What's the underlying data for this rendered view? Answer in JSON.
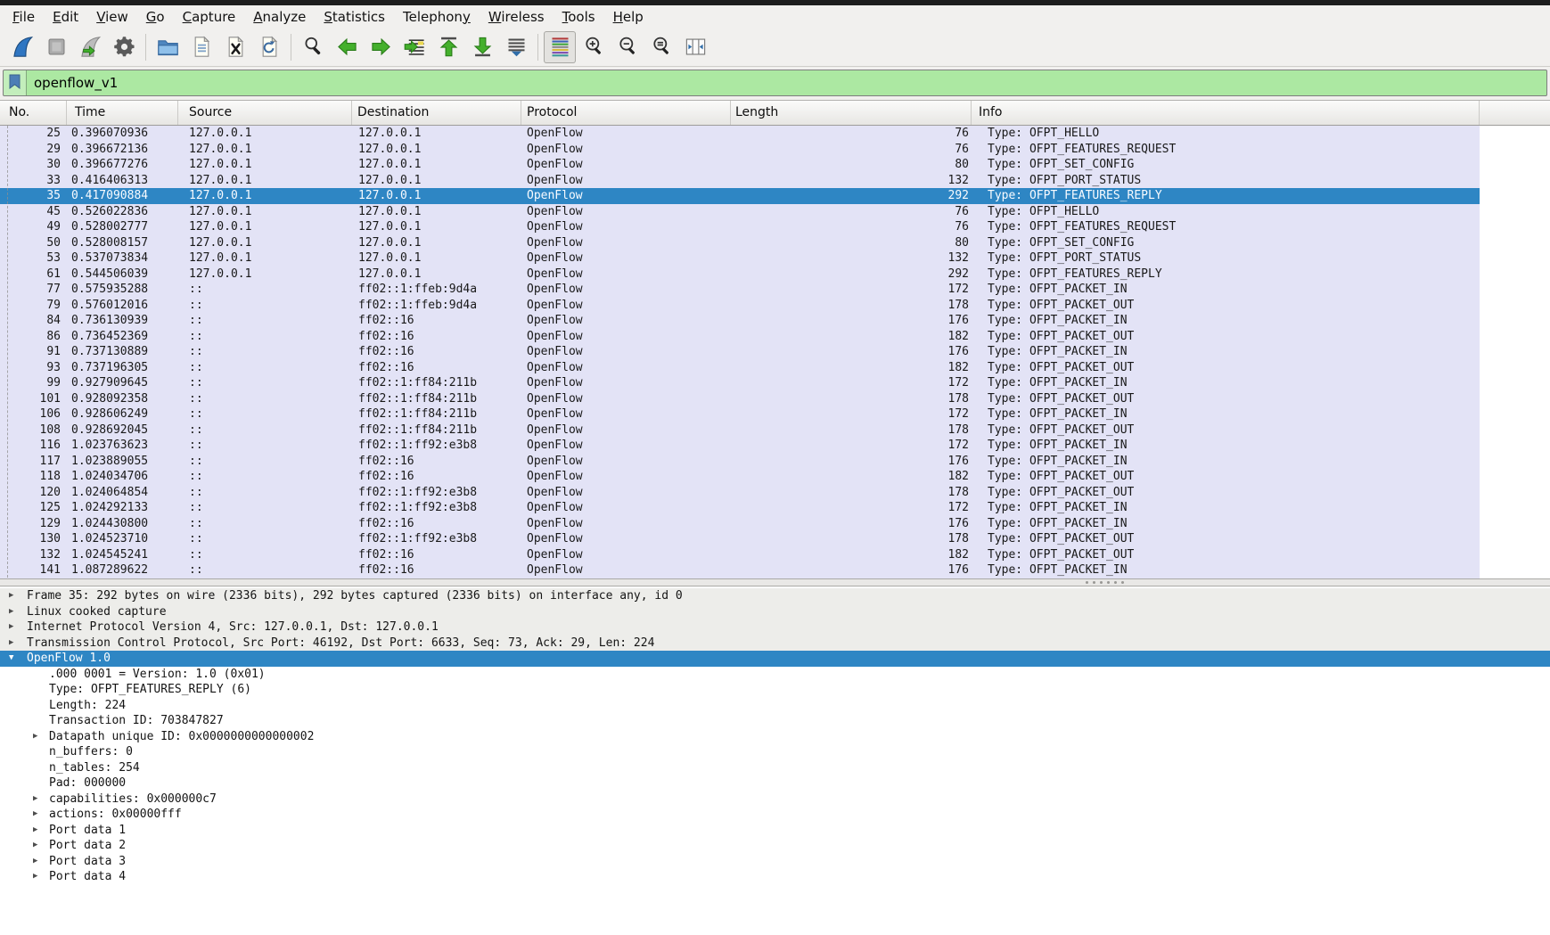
{
  "colors": {
    "selection_blue": "#2e86c4",
    "packet_row_lavender": "#e3e3f6",
    "filter_valid_green": "#ace8a2",
    "toolbar_gray": "#f1f0ee",
    "detail_shaded_gray": "#ededea"
  },
  "menu": {
    "items": [
      {
        "name": "file",
        "pre": "",
        "mn": "F",
        "post": "ile"
      },
      {
        "name": "edit",
        "pre": "",
        "mn": "E",
        "post": "dit"
      },
      {
        "name": "view",
        "pre": "",
        "mn": "V",
        "post": "iew"
      },
      {
        "name": "go",
        "pre": "",
        "mn": "G",
        "post": "o"
      },
      {
        "name": "capture",
        "pre": "",
        "mn": "C",
        "post": "apture"
      },
      {
        "name": "analyze",
        "pre": "",
        "mn": "A",
        "post": "nalyze"
      },
      {
        "name": "statistics",
        "pre": "",
        "mn": "S",
        "post": "tatistics"
      },
      {
        "name": "telephony",
        "pre": "Telephon",
        "mn": "y",
        "post": ""
      },
      {
        "name": "wireless",
        "pre": "",
        "mn": "W",
        "post": "ireless"
      },
      {
        "name": "tools",
        "pre": "",
        "mn": "T",
        "post": "ools"
      },
      {
        "name": "help",
        "pre": "",
        "mn": "H",
        "post": "elp"
      }
    ]
  },
  "toolbar": {
    "buttons": [
      {
        "name": "start-capture",
        "icon": "wireshark-fin-start-icon"
      },
      {
        "name": "stop-capture",
        "icon": "stop-icon"
      },
      {
        "name": "restart-capture",
        "icon": "restart-capture-icon"
      },
      {
        "name": "capture-options",
        "icon": "gear-icon"
      },
      {
        "name": "open-capture-file",
        "icon": "folder-open-icon",
        "separator_before": true
      },
      {
        "name": "save-capture-file",
        "icon": "save-file-icon"
      },
      {
        "name": "close-capture-file",
        "icon": "close-file-icon"
      },
      {
        "name": "reload-capture-file",
        "icon": "reload-file-icon"
      },
      {
        "name": "find-packet",
        "icon": "find-packet-icon",
        "separator_before": true
      },
      {
        "name": "go-previous-packet",
        "icon": "arrow-left-icon"
      },
      {
        "name": "go-next-packet",
        "icon": "arrow-right-icon"
      },
      {
        "name": "go-to-packet",
        "icon": "go-to-packet-icon"
      },
      {
        "name": "go-first-packet",
        "icon": "arrow-first-icon"
      },
      {
        "name": "go-last-packet",
        "icon": "arrow-last-icon"
      },
      {
        "name": "auto-scroll",
        "icon": "auto-scroll-icon"
      },
      {
        "name": "colorize-packets",
        "icon": "colorize-icon",
        "separator_before": true,
        "pressed": true
      },
      {
        "name": "zoom-in",
        "icon": "zoom-in-icon"
      },
      {
        "name": "zoom-out",
        "icon": "zoom-out-icon"
      },
      {
        "name": "zoom-original",
        "icon": "zoom-original-icon"
      },
      {
        "name": "resize-columns",
        "icon": "resize-columns-icon"
      }
    ]
  },
  "filter": {
    "value": "openflow_v1",
    "icon": "bookmark-icon"
  },
  "packet_list": {
    "columns": [
      "No.",
      "Time",
      "Source",
      "Destination",
      "Protocol",
      "Length",
      "Info"
    ],
    "rows": [
      {
        "no": "25",
        "time": "0.396070936",
        "source": "127.0.0.1",
        "destination": "127.0.0.1",
        "protocol": "OpenFlow",
        "length": "76",
        "info": "Type: OFPT_HELLO",
        "selected": false
      },
      {
        "no": "29",
        "time": "0.396672136",
        "source": "127.0.0.1",
        "destination": "127.0.0.1",
        "protocol": "OpenFlow",
        "length": "76",
        "info": "Type: OFPT_FEATURES_REQUEST",
        "selected": false
      },
      {
        "no": "30",
        "time": "0.396677276",
        "source": "127.0.0.1",
        "destination": "127.0.0.1",
        "protocol": "OpenFlow",
        "length": "80",
        "info": "Type: OFPT_SET_CONFIG",
        "selected": false
      },
      {
        "no": "33",
        "time": "0.416406313",
        "source": "127.0.0.1",
        "destination": "127.0.0.1",
        "protocol": "OpenFlow",
        "length": "132",
        "info": "Type: OFPT_PORT_STATUS",
        "selected": false
      },
      {
        "no": "35",
        "time": "0.417090884",
        "source": "127.0.0.1",
        "destination": "127.0.0.1",
        "protocol": "OpenFlow",
        "length": "292",
        "info": "Type: OFPT_FEATURES_REPLY",
        "selected": true
      },
      {
        "no": "45",
        "time": "0.526022836",
        "source": "127.0.0.1",
        "destination": "127.0.0.1",
        "protocol": "OpenFlow",
        "length": "76",
        "info": "Type: OFPT_HELLO",
        "selected": false
      },
      {
        "no": "49",
        "time": "0.528002777",
        "source": "127.0.0.1",
        "destination": "127.0.0.1",
        "protocol": "OpenFlow",
        "length": "76",
        "info": "Type: OFPT_FEATURES_REQUEST",
        "selected": false
      },
      {
        "no": "50",
        "time": "0.528008157",
        "source": "127.0.0.1",
        "destination": "127.0.0.1",
        "protocol": "OpenFlow",
        "length": "80",
        "info": "Type: OFPT_SET_CONFIG",
        "selected": false
      },
      {
        "no": "53",
        "time": "0.537073834",
        "source": "127.0.0.1",
        "destination": "127.0.0.1",
        "protocol": "OpenFlow",
        "length": "132",
        "info": "Type: OFPT_PORT_STATUS",
        "selected": false
      },
      {
        "no": "61",
        "time": "0.544506039",
        "source": "127.0.0.1",
        "destination": "127.0.0.1",
        "protocol": "OpenFlow",
        "length": "292",
        "info": "Type: OFPT_FEATURES_REPLY",
        "selected": false
      },
      {
        "no": "77",
        "time": "0.575935288",
        "source": "::",
        "destination": "ff02::1:ffeb:9d4a",
        "protocol": "OpenFlow",
        "length": "172",
        "info": "Type: OFPT_PACKET_IN",
        "selected": false
      },
      {
        "no": "79",
        "time": "0.576012016",
        "source": "::",
        "destination": "ff02::1:ffeb:9d4a",
        "protocol": "OpenFlow",
        "length": "178",
        "info": "Type: OFPT_PACKET_OUT",
        "selected": false
      },
      {
        "no": "84",
        "time": "0.736130939",
        "source": "::",
        "destination": "ff02::16",
        "protocol": "OpenFlow",
        "length": "176",
        "info": "Type: OFPT_PACKET_IN",
        "selected": false
      },
      {
        "no": "86",
        "time": "0.736452369",
        "source": "::",
        "destination": "ff02::16",
        "protocol": "OpenFlow",
        "length": "182",
        "info": "Type: OFPT_PACKET_OUT",
        "selected": false
      },
      {
        "no": "91",
        "time": "0.737130889",
        "source": "::",
        "destination": "ff02::16",
        "protocol": "OpenFlow",
        "length": "176",
        "info": "Type: OFPT_PACKET_IN",
        "selected": false
      },
      {
        "no": "93",
        "time": "0.737196305",
        "source": "::",
        "destination": "ff02::16",
        "protocol": "OpenFlow",
        "length": "182",
        "info": "Type: OFPT_PACKET_OUT",
        "selected": false
      },
      {
        "no": "99",
        "time": "0.927909645",
        "source": "::",
        "destination": "ff02::1:ff84:211b",
        "protocol": "OpenFlow",
        "length": "172",
        "info": "Type: OFPT_PACKET_IN",
        "selected": false
      },
      {
        "no": "101",
        "time": "0.928092358",
        "source": "::",
        "destination": "ff02::1:ff84:211b",
        "protocol": "OpenFlow",
        "length": "178",
        "info": "Type: OFPT_PACKET_OUT",
        "selected": false
      },
      {
        "no": "106",
        "time": "0.928606249",
        "source": "::",
        "destination": "ff02::1:ff84:211b",
        "protocol": "OpenFlow",
        "length": "172",
        "info": "Type: OFPT_PACKET_IN",
        "selected": false
      },
      {
        "no": "108",
        "time": "0.928692045",
        "source": "::",
        "destination": "ff02::1:ff84:211b",
        "protocol": "OpenFlow",
        "length": "178",
        "info": "Type: OFPT_PACKET_OUT",
        "selected": false
      },
      {
        "no": "116",
        "time": "1.023763623",
        "source": "::",
        "destination": "ff02::1:ff92:e3b8",
        "protocol": "OpenFlow",
        "length": "172",
        "info": "Type: OFPT_PACKET_IN",
        "selected": false
      },
      {
        "no": "117",
        "time": "1.023889055",
        "source": "::",
        "destination": "ff02::16",
        "protocol": "OpenFlow",
        "length": "176",
        "info": "Type: OFPT_PACKET_IN",
        "selected": false
      },
      {
        "no": "118",
        "time": "1.024034706",
        "source": "::",
        "destination": "ff02::16",
        "protocol": "OpenFlow",
        "length": "182",
        "info": "Type: OFPT_PACKET_OUT",
        "selected": false
      },
      {
        "no": "120",
        "time": "1.024064854",
        "source": "::",
        "destination": "ff02::1:ff92:e3b8",
        "protocol": "OpenFlow",
        "length": "178",
        "info": "Type: OFPT_PACKET_OUT",
        "selected": false
      },
      {
        "no": "125",
        "time": "1.024292133",
        "source": "::",
        "destination": "ff02::1:ff92:e3b8",
        "protocol": "OpenFlow",
        "length": "172",
        "info": "Type: OFPT_PACKET_IN",
        "selected": false
      },
      {
        "no": "129",
        "time": "1.024430800",
        "source": "::",
        "destination": "ff02::16",
        "protocol": "OpenFlow",
        "length": "176",
        "info": "Type: OFPT_PACKET_IN",
        "selected": false
      },
      {
        "no": "130",
        "time": "1.024523710",
        "source": "::",
        "destination": "ff02::1:ff92:e3b8",
        "protocol": "OpenFlow",
        "length": "178",
        "info": "Type: OFPT_PACKET_OUT",
        "selected": false
      },
      {
        "no": "132",
        "time": "1.024545241",
        "source": "::",
        "destination": "ff02::16",
        "protocol": "OpenFlow",
        "length": "182",
        "info": "Type: OFPT_PACKET_OUT",
        "selected": false
      },
      {
        "no": "141",
        "time": "1.087289622",
        "source": "::",
        "destination": "ff02::16",
        "protocol": "OpenFlow",
        "length": "176",
        "info": "Type: OFPT_PACKET_IN",
        "selected": false
      }
    ]
  },
  "detail": {
    "rows": [
      {
        "text": "Frame 35: 292 bytes on wire (2336 bits), 292 bytes captured (2336 bits) on interface any, id 0",
        "indent": 0,
        "arrow": "collapsed",
        "style": "gray"
      },
      {
        "text": "Linux cooked capture",
        "indent": 0,
        "arrow": "collapsed",
        "style": "gray"
      },
      {
        "text": "Internet Protocol Version 4, Src: 127.0.0.1, Dst: 127.0.0.1",
        "indent": 0,
        "arrow": "collapsed",
        "style": "gray"
      },
      {
        "text": "Transmission Control Protocol, Src Port: 46192, Dst Port: 6633, Seq: 73, Ack: 29, Len: 224",
        "indent": 0,
        "arrow": "collapsed",
        "style": "gray"
      },
      {
        "text": "OpenFlow 1.0",
        "indent": 0,
        "arrow": "expanded",
        "style": "selected"
      },
      {
        "text": ".000 0001 = Version: 1.0 (0x01)",
        "indent": 1,
        "arrow": "none",
        "style": "plain"
      },
      {
        "text": "Type: OFPT_FEATURES_REPLY (6)",
        "indent": 1,
        "arrow": "none",
        "style": "plain"
      },
      {
        "text": "Length: 224",
        "indent": 1,
        "arrow": "none",
        "style": "plain"
      },
      {
        "text": "Transaction ID: 703847827",
        "indent": 1,
        "arrow": "none",
        "style": "plain"
      },
      {
        "text": "Datapath unique ID: 0x0000000000000002",
        "indent": 1,
        "arrow": "collapsed",
        "style": "plain"
      },
      {
        "text": "n_buffers: 0",
        "indent": 1,
        "arrow": "none",
        "style": "plain"
      },
      {
        "text": "n_tables: 254",
        "indent": 1,
        "arrow": "none",
        "style": "plain"
      },
      {
        "text": "Pad: 000000",
        "indent": 1,
        "arrow": "none",
        "style": "plain"
      },
      {
        "text": "capabilities: 0x000000c7",
        "indent": 1,
        "arrow": "collapsed",
        "style": "plain"
      },
      {
        "text": "actions: 0x00000fff",
        "indent": 1,
        "arrow": "collapsed",
        "style": "plain"
      },
      {
        "text": "Port data 1",
        "indent": 1,
        "arrow": "collapsed",
        "style": "plain"
      },
      {
        "text": "Port data 2",
        "indent": 1,
        "arrow": "collapsed",
        "style": "plain"
      },
      {
        "text": "Port data 3",
        "indent": 1,
        "arrow": "collapsed",
        "style": "plain"
      },
      {
        "text": "Port data 4",
        "indent": 1,
        "arrow": "collapsed",
        "style": "plain"
      }
    ]
  }
}
